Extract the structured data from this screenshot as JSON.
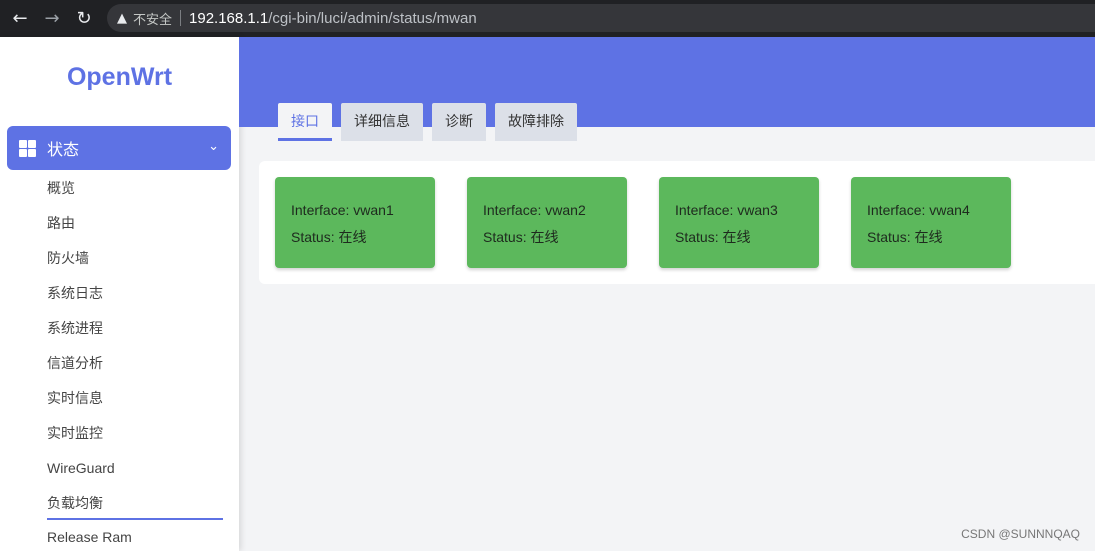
{
  "browser": {
    "back_icon": "←",
    "forward_icon": "→",
    "reload_icon": "↻",
    "warning_icon": "▲",
    "insecure_label": "不安全",
    "url_host": "192.168.1.1",
    "url_path": "/cgi-bin/luci/admin/status/mwan"
  },
  "sidebar": {
    "logo": "OpenWrt",
    "status_menu": {
      "label": "状态",
      "chevron": "⌄"
    },
    "items": [
      {
        "label": "概览"
      },
      {
        "label": "路由"
      },
      {
        "label": "防火墙"
      },
      {
        "label": "系统日志"
      },
      {
        "label": "系统进程"
      },
      {
        "label": "信道分析"
      },
      {
        "label": "实时信息"
      },
      {
        "label": "实时监控"
      },
      {
        "label": "WireGuard"
      },
      {
        "label": "负载均衡"
      },
      {
        "label": "Release Ram"
      }
    ]
  },
  "tabs": [
    {
      "label": "接口"
    },
    {
      "label": "详细信息"
    },
    {
      "label": "诊断"
    },
    {
      "label": "故障排除"
    }
  ],
  "interfaces": [
    {
      "interface": "Interface: vwan1",
      "status": "Status: 在线"
    },
    {
      "interface": "Interface: vwan2",
      "status": "Status: 在线"
    },
    {
      "interface": "Interface: vwan3",
      "status": "Status: 在线"
    },
    {
      "interface": "Interface: vwan4",
      "status": "Status: 在线"
    }
  ],
  "watermark": "CSDN @SUNNNQAQ",
  "colors": {
    "accent": "#5e72e4",
    "online": "#5cb85c",
    "chrome": "#202124"
  }
}
